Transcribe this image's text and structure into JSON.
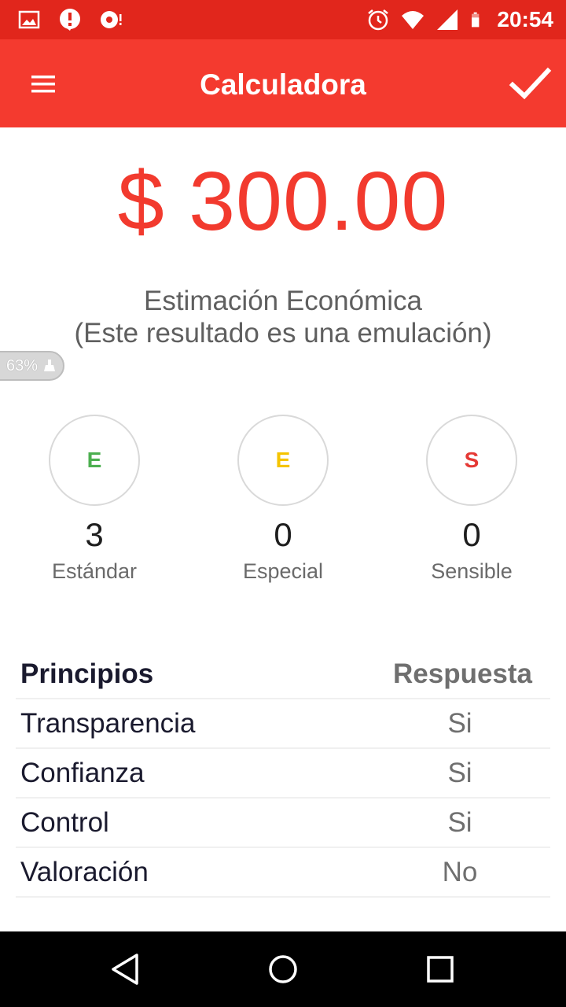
{
  "status_bar": {
    "time": "20:54",
    "icons": [
      "image-icon",
      "alert-icon",
      "media-icon",
      "alarm-icon",
      "wifi-icon",
      "signal-icon",
      "battery-icon"
    ]
  },
  "app_bar": {
    "title": "Calculadora",
    "menu_icon": "menu-icon",
    "confirm_icon": "check-icon"
  },
  "result": {
    "amount": "$ 300.00",
    "title": "Estimación Económica",
    "note": "(Este resultado es una emulación)"
  },
  "overlay": {
    "battery_percent": "63%"
  },
  "categories": [
    {
      "letter": "E",
      "count": "3",
      "label": "Estándar",
      "color": "#4caf50"
    },
    {
      "letter": "E",
      "count": "0",
      "label": "Especial",
      "color": "#f5c400"
    },
    {
      "letter": "S",
      "count": "0",
      "label": "Sensible",
      "color": "#e53935"
    }
  ],
  "table": {
    "headers": {
      "principle": "Principios",
      "answer": "Respuesta"
    },
    "rows": [
      {
        "principle": "Transparencia",
        "answer": "Si"
      },
      {
        "principle": "Confianza",
        "answer": "Si"
      },
      {
        "principle": "Control",
        "answer": "Si"
      },
      {
        "principle": "Valoración",
        "answer": "No"
      }
    ]
  },
  "colors": {
    "status_bar": "#e1261c",
    "app_bar": "#f43a2f",
    "amount": "#f23a2e"
  }
}
